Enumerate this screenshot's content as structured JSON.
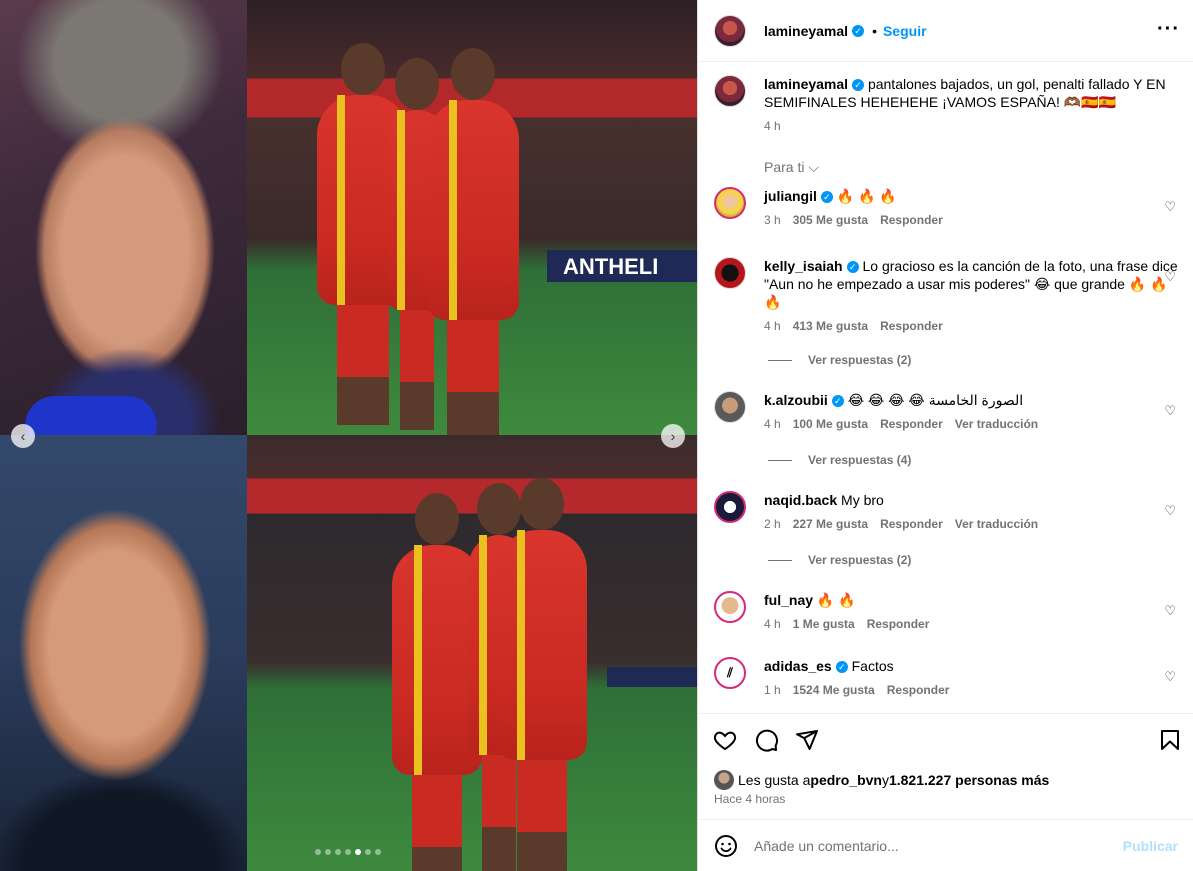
{
  "post": {
    "username": "lamineyamal",
    "follow_label": "Seguir",
    "separator": "•",
    "caption": "pantalones bajados, un gol, penalti fallado Y EN SEMIFINALES HEHEHEHE ¡VAMOS ESPAÑA! 🫶🏾🇪🇸🇪🇸",
    "time": "4 h",
    "for_you_label": "Para ti",
    "media": {
      "board_text": "ANTHELI",
      "dots_total": 7,
      "dots_active_index": 4
    }
  },
  "comments": [
    {
      "username": "juliangil",
      "verified": true,
      "text": "🔥 🔥 🔥",
      "time": "3 h",
      "likes": "305 Me gusta",
      "reply": "Responder",
      "translate": "",
      "replies": ""
    },
    {
      "username": "kelly_isaiah",
      "verified": true,
      "text": "Lo gracioso es la canción de la foto, una frase dice \"Aun no he empezado a usar mis poderes\" 😂 que grande 🔥 🔥 🔥",
      "time": "4 h",
      "likes": "413 Me gusta",
      "reply": "Responder",
      "translate": "",
      "replies": "Ver respuestas (2)"
    },
    {
      "username": "k.alzoubii",
      "verified": true,
      "text": "😂 😂 😂 😂 الصورة الخامسة",
      "time": "4 h",
      "likes": "100 Me gusta",
      "reply": "Responder",
      "translate": "Ver traducción",
      "replies": "Ver respuestas (4)"
    },
    {
      "username": "naqid.back",
      "verified": false,
      "text": "My bro",
      "time": "2 h",
      "likes": "227 Me gusta",
      "reply": "Responder",
      "translate": "Ver traducción",
      "replies": "Ver respuestas (2)"
    },
    {
      "username": "ful_nay",
      "verified": false,
      "text": "🔥 🔥",
      "time": "4 h",
      "likes": "1 Me gusta",
      "reply": "Responder",
      "translate": "",
      "replies": ""
    },
    {
      "username": "adidas_es",
      "verified": true,
      "text": "Factos",
      "time": "1 h",
      "likes": "1524 Me gusta",
      "reply": "Responder",
      "translate": "",
      "replies": ""
    }
  ],
  "likes_line": {
    "prefix": "Les gusta a ",
    "user": "pedro_bvn",
    "middle": " y ",
    "count": "1.821.227 personas más"
  },
  "posted_ago": "Hace 4 horas",
  "composer": {
    "placeholder": "Añade un comentario...",
    "publish_label": "Publicar"
  },
  "icons": {
    "like": "heart-icon",
    "comment": "comment-icon",
    "share": "paper-plane-icon",
    "save": "bookmark-icon",
    "emoji": "smiley-icon",
    "more": "more-icon"
  },
  "colors": {
    "link": "#0095f6",
    "muted": "#737373",
    "publish_disabled": "#b2dffc"
  }
}
